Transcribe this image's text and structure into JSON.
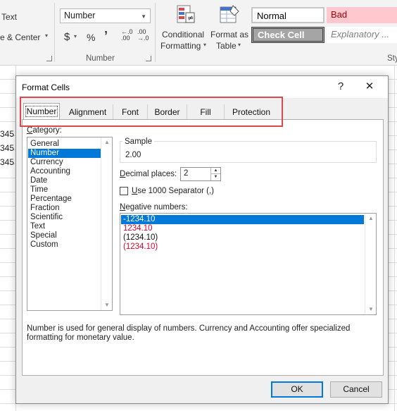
{
  "ribbon": {
    "align_text_label": "Text",
    "merge_center_label": "e & Center",
    "number_format_value": "Number",
    "currency_symbol": "$",
    "percent_symbol": "%",
    "comma_symbol": "’",
    "number_group_label": "Number",
    "conditional_formatting_line1": "Conditional",
    "conditional_formatting_line2": "Formatting",
    "format_as_table_line1": "Format as",
    "format_as_table_line2": "Table",
    "styles": {
      "normal": "Normal",
      "bad": "Bad",
      "check_cell": "Check Cell",
      "explanatory": "Explanatory ..."
    },
    "styles_group_label_partial": "Sty"
  },
  "sheet": {
    "partial_values": [
      "345",
      "345",
      "345"
    ]
  },
  "dialog": {
    "title": "Format Cells",
    "help_label": "?",
    "close_label": "✕",
    "tabs": [
      "Number",
      "Alignment",
      "Font",
      "Border",
      "Fill",
      "Protection"
    ],
    "active_tab": "Number",
    "category_label": "Category:",
    "categories": [
      "General",
      "Number",
      "Currency",
      "Accounting",
      "Date",
      "Time",
      "Percentage",
      "Fraction",
      "Scientific",
      "Text",
      "Special",
      "Custom"
    ],
    "selected_category": "Number",
    "sample_label": "Sample",
    "sample_value": "2.00",
    "decimal_places_label": "Decimal places:",
    "decimal_places_value": "2",
    "use_separator_label": "Use 1000 Separator (,)",
    "use_separator_checked": false,
    "negative_numbers_label": "Negative numbers:",
    "negative_numbers": [
      {
        "text": "-1234.10",
        "color": "#ffffff",
        "selected": true
      },
      {
        "text": "1234.10",
        "color": "#e0002a",
        "selected": false
      },
      {
        "text": "(1234.10)",
        "color": "#111111",
        "selected": false
      },
      {
        "text": "(1234.10)",
        "color": "#e0002a",
        "selected": false
      }
    ],
    "description": "Number is used for general display of numbers.  Currency and Accounting offer specialized formatting for monetary value.",
    "ok_label": "OK",
    "cancel_label": "Cancel"
  },
  "colors": {
    "accent": "#0078d7",
    "highlight_border": "#e0474c",
    "bad_bg": "#ffc7ce",
    "bad_text": "#9c0006",
    "check_cell_bg": "#a5a5a5"
  }
}
